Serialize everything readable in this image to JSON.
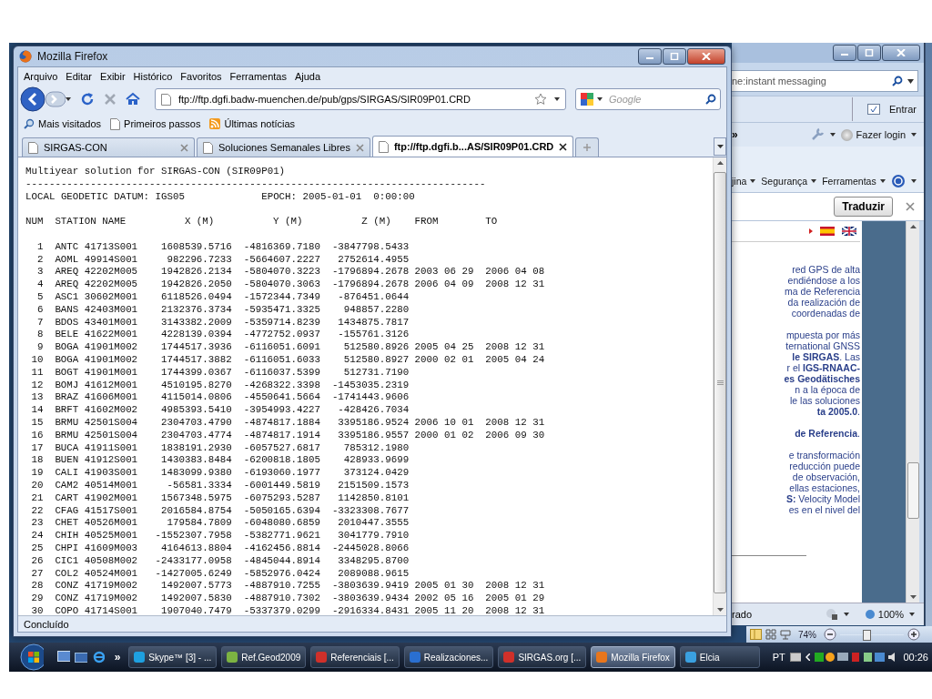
{
  "firefox": {
    "title": "Mozilla Firefox",
    "menu": [
      "Arquivo",
      "Editar",
      "Exibir",
      "Histórico",
      "Favoritos",
      "Ferramentas",
      "Ajuda"
    ],
    "url": "ftp://ftp.dgfi.badw-muenchen.de/pub/gps/SIRGAS/SIR09P01.CRD",
    "search_placeholder": "Google",
    "bookmarks": [
      "Mais visitados",
      "Primeiros passos",
      "Últimas notícias"
    ],
    "tabs": [
      {
        "label": "SIRGAS-CON",
        "selected": false
      },
      {
        "label": "Soluciones Semanales Libres",
        "selected": false
      },
      {
        "label": "ftp://ftp.dgfi.b...AS/SIR09P01.CRD",
        "selected": true
      }
    ],
    "document": {
      "heading": "Multiyear solution for SIRGAS-CON (SIR09P01)",
      "rule": "------------------------------------------------------------------------------",
      "datum": "LOCAL GEODETIC DATUM: IGS05",
      "epoch": "EPOCH: 2005-01-01  0:00:00",
      "columns": [
        "NUM",
        "STATION NAME",
        "X (M)",
        "Y (M)",
        "Z (M)",
        "FROM",
        "TO"
      ],
      "rows": [
        [
          "1",
          "ANTC 41713S001",
          "1608539.5716",
          "-4816369.7180",
          "-3847798.5433"
        ],
        [
          "2",
          "AOML 49914S001",
          "982296.7233",
          "-5664607.2227",
          "2752614.4955"
        ],
        [
          "3",
          "AREQ 42202M005",
          "1942826.2134",
          "-5804070.3223",
          "-1796894.2678",
          "2003 06 29",
          "2006 04 08"
        ],
        [
          "4",
          "AREQ 42202M005",
          "1942826.2050",
          "-5804070.3063",
          "-1796894.2678",
          "2006 04 09",
          "2008 12 31"
        ],
        [
          "5",
          "ASC1 30602M001",
          "6118526.0494",
          "-1572344.7349",
          "-876451.0644"
        ],
        [
          "6",
          "BANS 42403M001",
          "2132376.3734",
          "-5935471.3325",
          "948857.2280"
        ],
        [
          "7",
          "BDOS 43401M001",
          "3143382.2009",
          "-5359714.8239",
          "1434875.7817"
        ],
        [
          "8",
          "BELE 41622M001",
          "4228139.0394",
          "-4772752.0937",
          "-155761.3126"
        ],
        [
          "9",
          "BOGA 41901M002",
          "1744517.3936",
          "-6116051.6091",
          "512580.8926",
          "2005 04 25",
          "2008 12 31"
        ],
        [
          "10",
          "BOGA 41901M002",
          "1744517.3882",
          "-6116051.6033",
          "512580.8927",
          "2000 02 01",
          "2005 04 24"
        ],
        [
          "11",
          "BOGT 41901M001",
          "1744399.0367",
          "-6116037.5399",
          "512731.7190"
        ],
        [
          "12",
          "BOMJ 41612M001",
          "4510195.8270",
          "-4268322.3398",
          "-1453035.2319"
        ],
        [
          "13",
          "BRAZ 41606M001",
          "4115014.0806",
          "-4550641.5664",
          "-1741443.9606"
        ],
        [
          "14",
          "BRFT 41602M002",
          "4985393.5410",
          "-3954993.4227",
          "-428426.7034"
        ],
        [
          "15",
          "BRMU 42501S004",
          "2304703.4790",
          "-4874817.1884",
          "3395186.9524",
          "2006 10 01",
          "2008 12 31"
        ],
        [
          "16",
          "BRMU 42501S004",
          "2304703.4774",
          "-4874817.1914",
          "3395186.9557",
          "2000 01 02",
          "2006 09 30"
        ],
        [
          "17",
          "BUCA 41911S001",
          "1838191.2930",
          "-6057527.6817",
          "785312.1980"
        ],
        [
          "18",
          "BUEN 41912S001",
          "1430383.8484",
          "-6200818.1805",
          "428933.9699"
        ],
        [
          "19",
          "CALI 41903S001",
          "1483099.9380",
          "-6193060.1977",
          "373124.0429"
        ],
        [
          "20",
          "CAM2 40514M001",
          "-56581.3334",
          "-6001449.5819",
          "2151509.1573"
        ],
        [
          "21",
          "CART 41902M001",
          "1567348.5975",
          "-6075293.5287",
          "1142850.8101"
        ],
        [
          "22",
          "CFAG 41517S001",
          "2016584.8754",
          "-5050165.6394",
          "-3323308.7677"
        ],
        [
          "23",
          "CHET 40526M001",
          "179584.7809",
          "-6048080.6859",
          "2010447.3555"
        ],
        [
          "24",
          "CHIH 40525M001",
          "-1552307.7958",
          "-5382771.9621",
          "3041779.7910"
        ],
        [
          "25",
          "CHPI 41609M003",
          "4164613.8804",
          "-4162456.8814",
          "-2445028.8066"
        ],
        [
          "26",
          "CIC1 40508M002",
          "-2433177.0958",
          "-4845044.8914",
          "3348295.8700"
        ],
        [
          "27",
          "COL2 40524M001",
          "-1427005.6249",
          "-5852976.0424",
          "2089088.9615"
        ],
        [
          "28",
          "CONZ 41719M002",
          "1492007.5773",
          "-4887910.7255",
          "-3803639.9419",
          "2005 01 30",
          "2008 12 31"
        ],
        [
          "29",
          "CONZ 41719M002",
          "1492007.5830",
          "-4887910.7302",
          "-3803639.9434",
          "2002 05 16",
          "2005 01 29"
        ],
        [
          "30",
          "COPO 41714S001",
          "1907040.7479",
          "-5337379.0299",
          "-2916334.8431",
          "2005 11 20",
          "2008 12 31"
        ]
      ]
    },
    "status": "Concluído"
  },
  "ie_window": {
    "search_value": "ne:instant messaging",
    "entrar": "Entrar",
    "chevron": "»",
    "login": "Fazer login",
    "command_menus": [
      "jina",
      "Segurança",
      "Ferramentas"
    ],
    "translate_button": "Traduzir",
    "paragraphs": [
      [
        "red GPS de alta",
        "endiéndose a los",
        "ma de Referencia",
        "da realización de",
        "coordenadas de"
      ],
      [
        "mpuesta por más",
        "ternational GNSS",
        "**le SIRGAS**. Las",
        "r el **IGS-RNAAC-**",
        "**es Geodätisches**",
        "n a la época de",
        "le las soluciones",
        "**ta 2005.0**."
      ],
      [
        "**de Referencia**."
      ],
      [
        "e transformación",
        "reducción puede",
        "de observación,",
        "ellas estaciones,",
        "**S:** Velocity Model",
        "es en el nivel del"
      ]
    ],
    "status": "rado",
    "zoom": "100%"
  },
  "office_status": {
    "zoom": "74%",
    "level": 0.4
  },
  "taskbar": {
    "chevron": "»",
    "items": [
      {
        "label": "Skype™ [3] - ...",
        "selected": false
      },
      {
        "label": "Ref.Geod2009",
        "selected": false
      },
      {
        "label": "Referenciais [...",
        "selected": false
      },
      {
        "label": "Realizaciones...",
        "selected": false
      },
      {
        "label": "SIRGAS.org [...",
        "selected": false
      },
      {
        "label": "Mozilla Firefox",
        "selected": true
      },
      {
        "label": "Elcia",
        "selected": false
      }
    ],
    "language": "PT",
    "clock": "00:26"
  }
}
